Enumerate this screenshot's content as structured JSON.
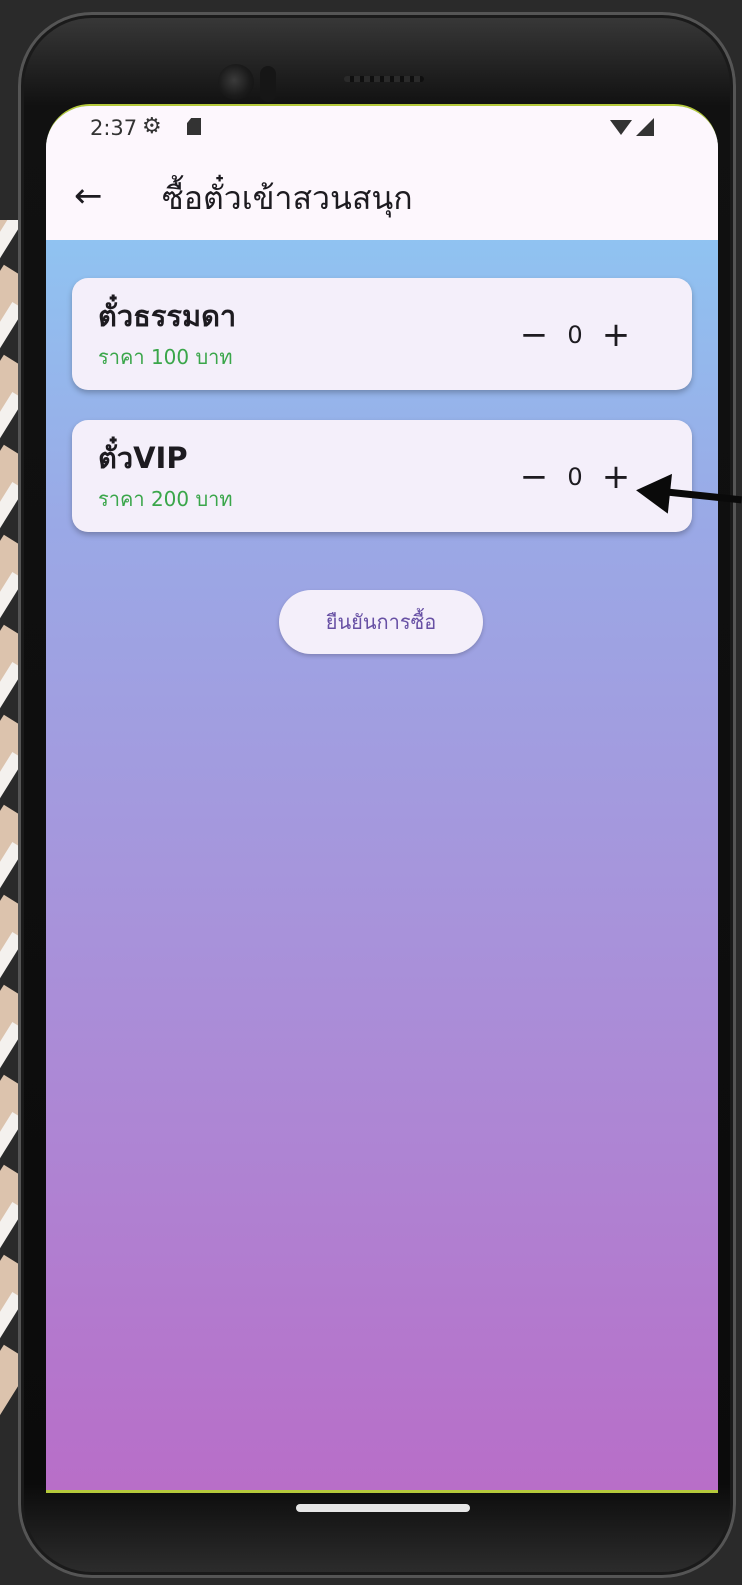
{
  "status_bar": {
    "time": "2:37",
    "icons": [
      "gear-icon",
      "sd-card-icon",
      "wifi-icon",
      "signal-icon"
    ]
  },
  "app_bar": {
    "back_icon": "arrow-left-icon",
    "title": "ซื้อตั๋วเข้าสวนสนุก"
  },
  "tickets": [
    {
      "name": "ตั๋วธรรมดา",
      "price": "ราคา 100 บาท",
      "count": "0",
      "minus": "−",
      "plus": "+"
    },
    {
      "name": "ตั๋วVIP",
      "price": "ราคา 200 บาท",
      "count": "0",
      "minus": "−",
      "plus": "+"
    }
  ],
  "confirm_button": {
    "label": "ยืนยันการซื้อ"
  },
  "colors": {
    "price_text": "#3aa64a",
    "card_bg": "#f4effa",
    "button_text": "#6750a4",
    "gradient_top": "#8fc5f2",
    "gradient_bottom": "#b86ec8"
  }
}
